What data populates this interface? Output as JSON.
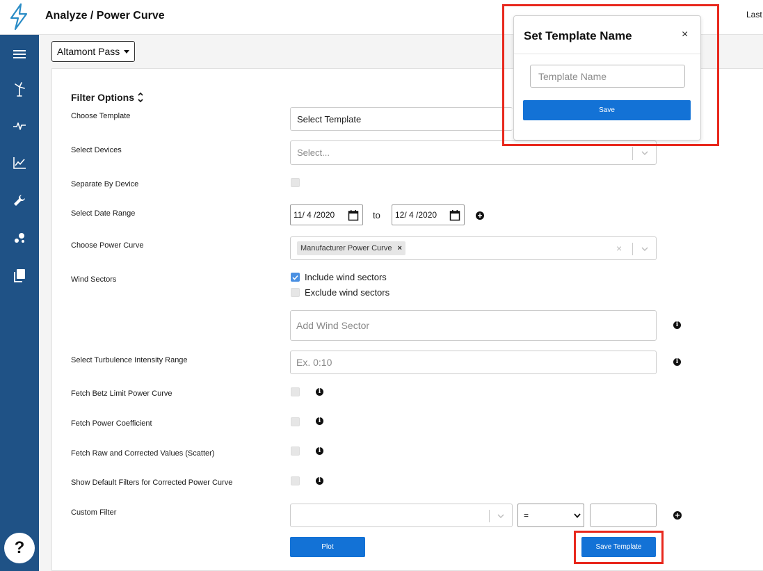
{
  "header": {
    "title": "Analyze / Power Curve",
    "last_label": "Last"
  },
  "sidebar": {
    "items": [
      {
        "icon": "hamburger-menu-icon"
      },
      {
        "icon": "wind-turbine-icon"
      },
      {
        "icon": "pulse-icon"
      },
      {
        "icon": "line-chart-icon"
      },
      {
        "icon": "wrench-icon"
      },
      {
        "icon": "scatter-dots-icon"
      },
      {
        "icon": "documents-icon"
      }
    ],
    "help_label": "?"
  },
  "site": {
    "label": "Altamont Pass"
  },
  "filters": {
    "title": "Filter Options",
    "choose_template": {
      "label": "Choose Template",
      "value": "Select Template"
    },
    "select_devices": {
      "label": "Select Devices",
      "placeholder": "Select..."
    },
    "separate_by_device": {
      "label": "Separate By Device",
      "checked": false
    },
    "date_range": {
      "label": "Select Date Range",
      "start": "11/ 4 /2020",
      "to_label": "to",
      "end": "12/ 4 /2020"
    },
    "power_curve": {
      "label": "Choose Power Curve",
      "selected": "Manufacturer Power Curve",
      "remove_glyph": "×",
      "clear_glyph": "×"
    },
    "wind_sectors": {
      "label": "Wind Sectors",
      "include_label": "Include wind sectors",
      "include_checked": true,
      "exclude_label": "Exclude wind sectors",
      "exclude_checked": false,
      "add_placeholder": "Add Wind Sector"
    },
    "turbulence": {
      "label": "Select Turbulence Intensity Range",
      "placeholder": "Ex. 0:10"
    },
    "betz": {
      "label": "Fetch Betz Limit Power Curve",
      "checked": false
    },
    "power_coefficient": {
      "label": "Fetch Power Coefficient",
      "checked": false
    },
    "raw_corrected": {
      "label": "Fetch Raw and Corrected Values (Scatter)",
      "checked": false
    },
    "default_filters": {
      "label": "Show Default Filters for Corrected Power Curve",
      "checked": false
    },
    "custom_filter": {
      "label": "Custom Filter",
      "field_value": "",
      "operator": "=",
      "value": ""
    },
    "plot_label": "Plot",
    "save_template_label": "Save Template"
  },
  "modal": {
    "title": "Set Template Name",
    "close_glyph": "×",
    "input_placeholder": "Template Name",
    "save_label": "Save"
  },
  "colors": {
    "sidebar": "#1f5286",
    "primary_button": "#1372d6",
    "highlight": "#e8281d",
    "checkbox_on": "#4a90e2"
  }
}
